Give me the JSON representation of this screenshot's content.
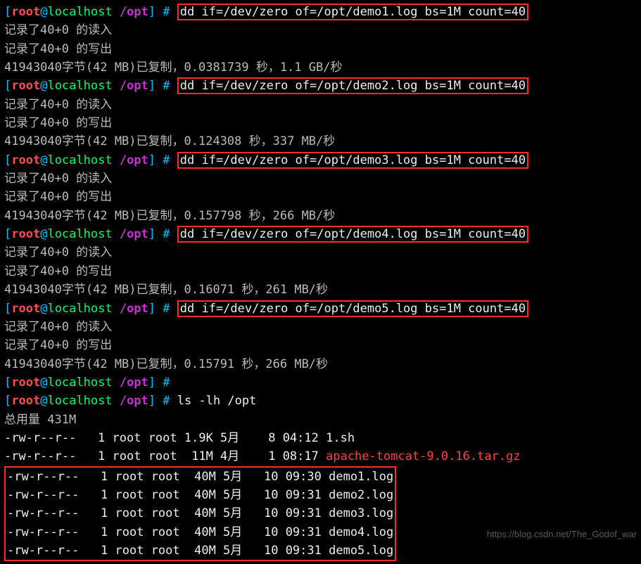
{
  "prompt": {
    "user": "root",
    "host": "localhost",
    "path": "/opt",
    "symbol": "#"
  },
  "blocks": [
    {
      "cmd": "dd if=/dev/zero of=/opt/demo1.log bs=1M count=40",
      "out1": "记录了40+0 的读入",
      "out2": "记录了40+0 的写出",
      "out3": "41943040字节(42 MB)已复制，0.0381739 秒，1.1 GB/秒"
    },
    {
      "cmd": "dd if=/dev/zero of=/opt/demo2.log bs=1M count=40",
      "out1": "记录了40+0 的读入",
      "out2": "记录了40+0 的写出",
      "out3": "41943040字节(42 MB)已复制，0.124308 秒，337 MB/秒"
    },
    {
      "cmd": "dd if=/dev/zero of=/opt/demo3.log bs=1M count=40",
      "out1": "记录了40+0 的读入",
      "out2": "记录了40+0 的写出",
      "out3": "41943040字节(42 MB)已复制，0.157798 秒，266 MB/秒"
    },
    {
      "cmd": "dd if=/dev/zero of=/opt/demo4.log bs=1M count=40",
      "out1": "记录了40+0 的读入",
      "out2": "记录了40+0 的写出",
      "out3": "41943040字节(42 MB)已复制，0.16071 秒，261 MB/秒"
    },
    {
      "cmd": "dd if=/dev/zero of=/opt/demo5.log bs=1M count=40",
      "out1": "记录了40+0 的读入",
      "out2": "记录了40+0 的写出",
      "out3": "41943040字节(42 MB)已复制，0.15791 秒，266 MB/秒"
    }
  ],
  "empty_cmd": "",
  "ls_cmd": "ls -lh /opt",
  "ls_total": "总用量 431M",
  "ls_rows": [
    {
      "perm": "-rw-r--r--",
      "links": "1",
      "owner": "root",
      "group": "root",
      "size": "1.9K",
      "month": "5月",
      "day": "8",
      "time": "04:12",
      "name": "1.sh",
      "color": ""
    },
    {
      "perm": "-rw-r--r--",
      "links": "1",
      "owner": "root",
      "group": "root",
      "size": "11M",
      "month": "4月",
      "day": "1",
      "time": "08:17",
      "name": "apache-tomcat-9.0.16.tar.gz",
      "color": "file-hl"
    }
  ],
  "ls_highlight_rows": [
    {
      "perm": "-rw-r--r--",
      "links": "1",
      "owner": "root",
      "group": "root",
      "size": "40M",
      "month": "5月",
      "day": "10",
      "time": "09:30",
      "name": "demo1.log"
    },
    {
      "perm": "-rw-r--r--",
      "links": "1",
      "owner": "root",
      "group": "root",
      "size": "40M",
      "month": "5月",
      "day": "10",
      "time": "09:31",
      "name": "demo2.log"
    },
    {
      "perm": "-rw-r--r--",
      "links": "1",
      "owner": "root",
      "group": "root",
      "size": "40M",
      "month": "5月",
      "day": "10",
      "time": "09:31",
      "name": "demo3.log"
    },
    {
      "perm": "-rw-r--r--",
      "links": "1",
      "owner": "root",
      "group": "root",
      "size": "40M",
      "month": "5月",
      "day": "10",
      "time": "09:31",
      "name": "demo4.log"
    },
    {
      "perm": "-rw-r--r--",
      "links": "1",
      "owner": "root",
      "group": "root",
      "size": "40M",
      "month": "5月",
      "day": "10",
      "time": "09:31",
      "name": "demo5.log"
    }
  ],
  "watermark": "https://blog.csdn.net/The_Godof_war"
}
